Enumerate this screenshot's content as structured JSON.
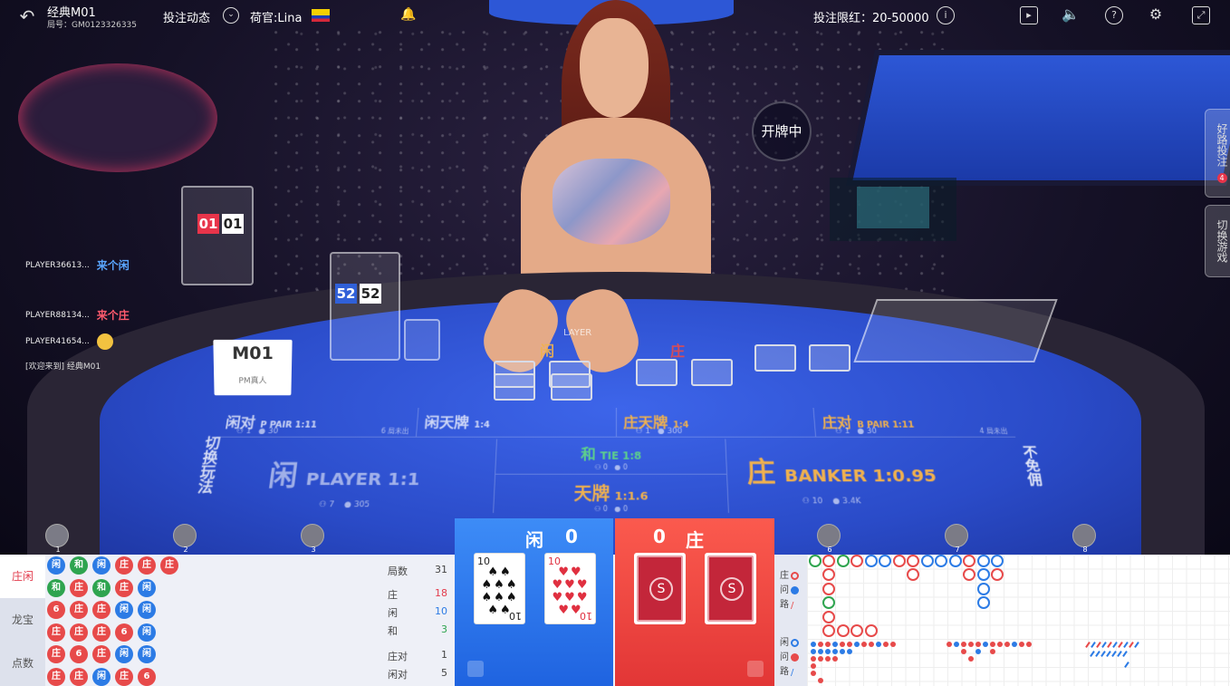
{
  "header": {
    "room_name": "经典M01",
    "room_id": "局号：GM0123326335",
    "bet_dynamics_label": "投注动态",
    "dealer_label": "荷官:Lina",
    "bet_limit_label": "投注限红：20-50000"
  },
  "status": {
    "dealing": "开牌中"
  },
  "side_tabs": [
    {
      "label": "好路投注",
      "badge": "4"
    },
    {
      "label": "切换游戏"
    }
  ],
  "table": {
    "code": "M01",
    "brand": "PM真人",
    "counters_left": [
      "01",
      "01"
    ],
    "counters_mid": [
      "52",
      "52"
    ],
    "card_labels": {
      "player": "LAYER",
      "player_cn": "闲",
      "banker_cn": "庄"
    },
    "bets": {
      "player_pair": {
        "cn": "闲对",
        "en": "P PAIR 1:11",
        "count": "1",
        "amount": "30",
        "side": "6 局未出"
      },
      "player_dragon": {
        "cn": "闲天牌",
        "en": "1:4"
      },
      "banker_dragon": {
        "cn": "庄天牌",
        "en": "1:4",
        "count": "1",
        "amount": "300"
      },
      "banker_pair": {
        "cn": "庄对",
        "en": "B PAIR 1:11",
        "count": "1",
        "amount": "30",
        "side": "4 局未出"
      },
      "player": {
        "cn": "闲",
        "en": "PLAYER 1:1",
        "count": "7",
        "amount": "305"
      },
      "tie": {
        "cn": "和",
        "en": "TIE 1:8",
        "count": "0",
        "amount": "0"
      },
      "super_six": {
        "cn": "天牌",
        "en": "1:1.6",
        "count": "0",
        "amount": "0"
      },
      "banker": {
        "cn": "庄",
        "en": "BANKER 1:0.95",
        "count": "10",
        "amount": "3.4K"
      },
      "switch_play": "切换玩法",
      "no_commission": "不免佣"
    }
  },
  "chat": [
    {
      "user": "PLAYER36613...",
      "sticker": "来个闲",
      "side": "p"
    },
    {
      "user": "PLAYER88134...",
      "sticker": "来个庄",
      "side": "b"
    },
    {
      "user": "PLAYER41654...",
      "sticker": "emoji",
      "side": "e"
    }
  ],
  "chat_welcome": "[欢迎来到] 经典M01",
  "seats": [
    "1",
    "2",
    "3",
    "6",
    "7",
    "8"
  ],
  "road_tabs": [
    "庄闲",
    "龙宝",
    "点数"
  ],
  "bead_road": [
    [
      "闲",
      "和",
      "闲",
      "庄",
      "庄",
      "庄"
    ],
    [
      "和",
      "庄",
      "和",
      "庄",
      "闲"
    ],
    [
      "6",
      "庄",
      "庄",
      "闲",
      "闲"
    ],
    [
      "庄",
      "庄",
      "庄",
      "6",
      "闲"
    ],
    [
      "庄",
      "6",
      "庄",
      "闲",
      "闲"
    ],
    [
      "庄",
      "庄",
      "闲",
      "庄",
      "6"
    ]
  ],
  "stats": {
    "rounds_label": "局数",
    "rounds": "31",
    "banker_label": "庄",
    "banker": "18",
    "player_label": "闲",
    "player": "10",
    "tie_label": "和",
    "tie": "3",
    "banker_pair_label": "庄对",
    "banker_pair": "1",
    "player_pair_label": "闲对",
    "player_pair": "5"
  },
  "result": {
    "player_label": "闲",
    "player_points": "0",
    "banker_label": "庄",
    "banker_points": "0",
    "player_sub": "",
    "banker_sub": "",
    "player_cards": [
      {
        "rank": "10",
        "suit": "♠",
        "red": false
      },
      {
        "rank": "10",
        "suit": "♥",
        "red": true
      }
    ]
  },
  "big_road_labels": {
    "banker_ask": [
      "庄",
      "问",
      "路"
    ],
    "player_ask": [
      "闲",
      "问",
      "路"
    ]
  },
  "colors": {
    "banker": "#e74a4a",
    "player": "#2c7be5",
    "tie": "#2ea44f",
    "gold": "#f0b14e"
  }
}
